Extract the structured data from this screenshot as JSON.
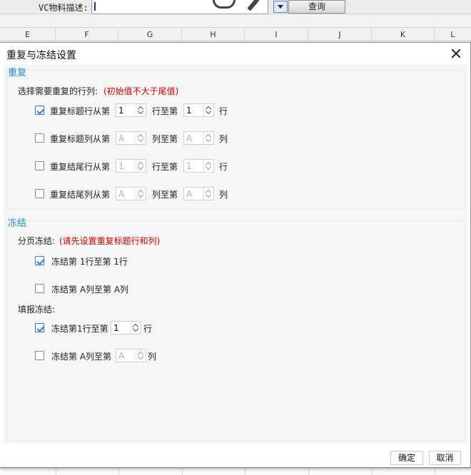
{
  "toolbar": {
    "field_label": "VC物料描述:",
    "field_value": "",
    "query_label": "查询"
  },
  "columns": [
    "E",
    "F",
    "G",
    "H",
    "I",
    "J",
    "K",
    "L"
  ],
  "dialog": {
    "title": "重复与冻结设置",
    "repeat": {
      "section_title": "重复",
      "prompt": "选择需要重复的行列:",
      "note": "(初始值不大于尾值)",
      "rows": [
        {
          "label": "重复标题行从第",
          "checked": true,
          "from": "1",
          "mid": "行至第",
          "to": "1",
          "unit": "行"
        },
        {
          "label": "重复标题列从第",
          "checked": false,
          "from": "A",
          "mid": "列至第",
          "to": "A",
          "unit": "列"
        },
        {
          "label": "重复结尾行从第",
          "checked": false,
          "from": "1",
          "mid": "行至第",
          "to": "1",
          "unit": "行"
        },
        {
          "label": "重复结尾列从第",
          "checked": false,
          "from": "A",
          "mid": "列至第",
          "to": "A",
          "unit": "列"
        }
      ]
    },
    "freeze": {
      "section_title": "冻结",
      "page_label": "分页冻结:",
      "page_note": "(请先设置重复标题行和列)",
      "page_row": {
        "label": "冻结第  1行至第  1行",
        "checked": true
      },
      "page_col": {
        "label": "冻结第  A列至第  A列",
        "checked": false
      },
      "fill_label": "填报冻结:",
      "fill_row": {
        "label": "冻结第1行至第",
        "value": "1",
        "unit": "行",
        "checked": true
      },
      "fill_col": {
        "label": "冻结第  A列至第",
        "value": "A",
        "unit": "列",
        "checked": false
      }
    },
    "buttons": {
      "ok": "确定",
      "cancel": "取消"
    }
  }
}
